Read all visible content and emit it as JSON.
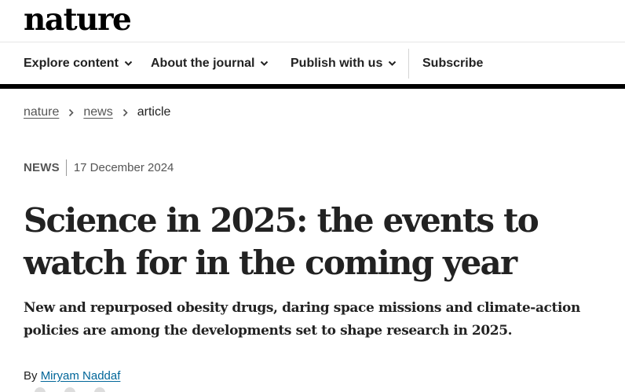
{
  "site": {
    "logo_text": "nature"
  },
  "nav": {
    "items": [
      {
        "label": "Explore content"
      },
      {
        "label": "About the journal"
      },
      {
        "label": "Publish with us"
      }
    ],
    "subscribe_label": "Subscribe"
  },
  "breadcrumb": {
    "items": [
      "nature",
      "news"
    ],
    "current": "article"
  },
  "article": {
    "type": "NEWS",
    "date": "17 December 2024",
    "title": "Science in 2025: the events to watch for in the coming year",
    "standfirst": "New and repurposed obesity drugs, daring space missions and climate-action policies are among the developments set to shape research in 2025.",
    "byline_prefix": "By",
    "author": "Miryam Naddaf"
  },
  "icons": {
    "nav_dropdown": "chevron-down-icon",
    "breadcrumb_separator": "chevron-right-icon"
  },
  "colors": {
    "text": "#222222",
    "link": "#006699",
    "muted": "#555555",
    "rule": "#000000"
  }
}
